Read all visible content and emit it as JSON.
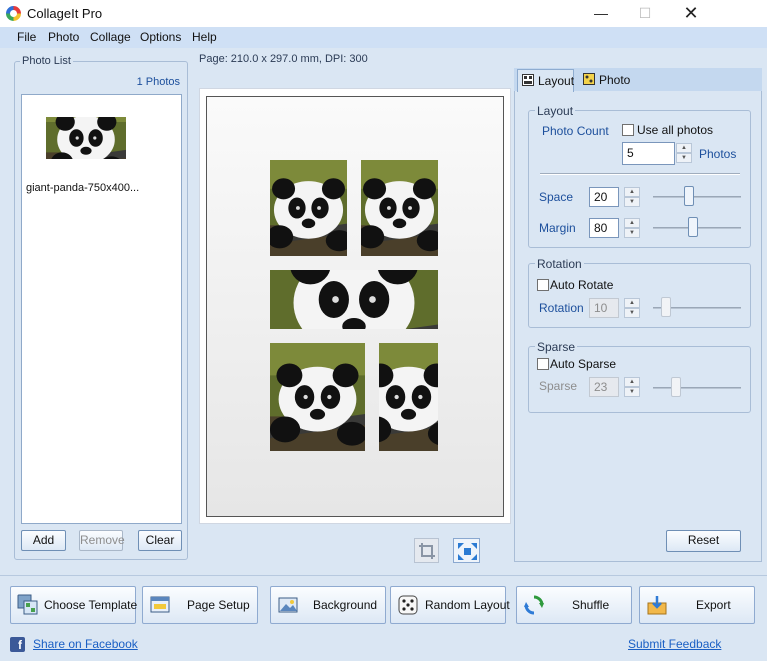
{
  "window": {
    "title": "CollageIt Pro",
    "min": "—",
    "max": "☐",
    "close": "✕"
  },
  "menu": [
    "File",
    "Photo",
    "Collage",
    "Options",
    "Help"
  ],
  "photo_list": {
    "title": "Photo List",
    "count": "1 Photos",
    "items": [
      {
        "name": "giant-panda-750x400..."
      }
    ],
    "add": "Add",
    "remove": "Remove",
    "clear": "Clear"
  },
  "page": {
    "info": "Page: 210.0 x 297.0 mm, DPI: 300"
  },
  "tabs": {
    "layout": "Layout",
    "photo": "Photo"
  },
  "layout_group": {
    "title": "Layout",
    "photo_count_label": "Photo Count",
    "use_all_label": "Use all photos",
    "use_all_checked": false,
    "photo_count": "5",
    "photos_unit": "Photos",
    "space_label": "Space",
    "space": "20",
    "space_slider": 0.4,
    "margin_label": "Margin",
    "margin": "80",
    "margin_slider": 0.45
  },
  "rotation_group": {
    "title": "Rotation",
    "auto_label": "Auto Rotate",
    "auto_checked": false,
    "rotation_label": "Rotation",
    "rotation": "10",
    "rotation_slider": 0.1
  },
  "sparse_group": {
    "title": "Sparse",
    "auto_label": "Auto Sparse",
    "auto_checked": false,
    "sparse_label": "Sparse",
    "sparse": "23",
    "sparse_slider": 0.23
  },
  "reset": "Reset",
  "toolbar": {
    "choose_template": "Choose Template",
    "page_setup": "Page Setup",
    "background": "Background",
    "random_layout": "Random Layout",
    "shuffle": "Shuffle",
    "export": "Export"
  },
  "footer": {
    "facebook": "Share on Facebook",
    "feedback": "Submit Feedback",
    "fb_glyph": "f"
  }
}
